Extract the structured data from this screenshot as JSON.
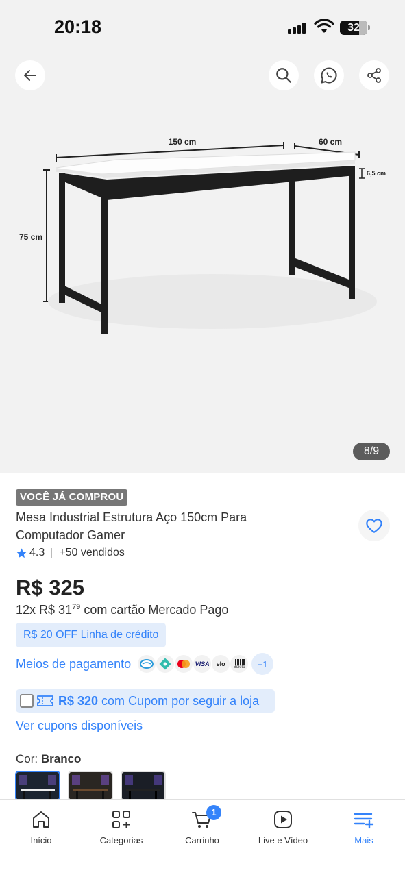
{
  "status_bar": {
    "time": "20:18",
    "battery": "32"
  },
  "gallery": {
    "counter": "8/9",
    "dimensions": {
      "width": "150 cm",
      "depth": "60 cm",
      "thickness": "6,5 cm",
      "height": "75 cm"
    }
  },
  "product": {
    "bought_badge": "VOCÊ JÁ COMPROU",
    "title": "Mesa Industrial Estrutura Aço 150cm Para Computador Gamer",
    "rating": "4.3",
    "sold": "+50 vendidos",
    "price": "R$ 325",
    "installments_prefix": "12x R$ 31",
    "installments_cents": "79",
    "installments_suffix": "com cartão Mercado Pago",
    "credit_offer": "R$ 20 OFF Linha de crédito",
    "payment_link": "Meios de pagamento",
    "payment_methods": [
      "mercado-pago-icon",
      "pix-icon",
      "mastercard-icon",
      "VISA",
      "elo",
      "Boleto"
    ],
    "payment_more": "+1",
    "coupon_amount": "R$ 320",
    "coupon_text": "com Cupom por seguir a loja",
    "coupons_link": "Ver cupons disponíveis",
    "color_label": "Cor:",
    "color_value": "Branco"
  },
  "nav": {
    "home": "Início",
    "categories": "Categorias",
    "cart": "Carrinho",
    "cart_count": "1",
    "live": "Live e Vídeo",
    "more": "Mais"
  },
  "colors": {
    "accent": "#3483fa",
    "badge_grey": "#777777",
    "bg_gallery": "#f2f2f2"
  }
}
